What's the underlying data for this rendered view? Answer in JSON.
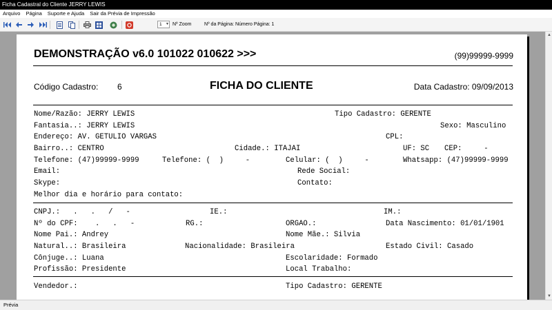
{
  "window": {
    "title": "Ficha Cadastral do Cliente JERRY LEWIS"
  },
  "menu": [
    "Arquivo",
    "Página",
    "Suporte e Ajuda",
    "Sair da Prévia de Impressão"
  ],
  "toolbar": {
    "icons": [
      "first-page-icon",
      "previous-page-icon",
      "next-page-icon",
      "last-page-icon",
      "single-page-icon",
      "two-pages-icon",
      "print-icon",
      "multi-page-icon",
      "export-icon",
      "close-icon"
    ],
    "zoom_value": "1",
    "zoom_label": "Nº Zoom",
    "page_info": "Nº da Página: Número Página: 1"
  },
  "report": {
    "title": "DEMONSTRAÇÃO v6.0 101022 010622 >>>",
    "phone": "(99)99999-9999",
    "codigo_label": "Código Cadastro:",
    "codigo_value": "6",
    "heading": "FICHA DO CLIENTE",
    "data_cadastro": "Data Cadastro: 09/09/2013",
    "nome": "Nome/Razão: JERRY LEWIS",
    "tipo_cadastro": "Tipo Cadastro: GERENTE",
    "fantasia": "Fantasia..: JERRY LEWIS",
    "sexo": "Sexo: Masculino",
    "endereco": "Endereço: AV. GETULIO VARGAS",
    "cpl": "CPL:",
    "bairro": "Bairro..: CENTRO",
    "cidade": "Cidade.: ITAJAI",
    "uf": "UF: SC",
    "cep": "CEP:     -",
    "telefone1": "Telefone: (47)99999-9999",
    "telefone2": "Telefone: (  )     -",
    "celular": "Celular: (  )     -",
    "whatsapp": "Whatsapp: (47)99999-9999",
    "email": "Email:",
    "rede_social": "Rede Social:",
    "skype": "Skype:",
    "contato": "Contato:",
    "melhor_dia": "Melhor dia e horário para contato:",
    "cnpj": "CNPJ.:   .   .   /   -",
    "ie": "IE.:",
    "im": "IM.:",
    "cpf": "Nº do CPF:    .   .   -",
    "rg": "RG.:",
    "orgao": "ORGAO.:",
    "data_nascimento": "Data Nascimento: 01/01/1901",
    "nome_pai": "Nome Pai.: Andrey",
    "nome_mae": "Nome Mãe.: Silvia",
    "natural": "Natural..: Brasileira",
    "nacionalidade": "Nacionalidade: Brasileira",
    "estado_civil": "Estado Civil: Casado",
    "conjuge": "Cônjuge..: Luana",
    "escolaridade": "Escolaridade: Formado",
    "profissao": "Profissão: Presidente",
    "local_trabalho": "Local Trabalho:",
    "vendedor": "Vendedor.:",
    "tipo_cadastro2": "Tipo Cadastro: GERENTE"
  },
  "status": {
    "text": "Prévia"
  }
}
